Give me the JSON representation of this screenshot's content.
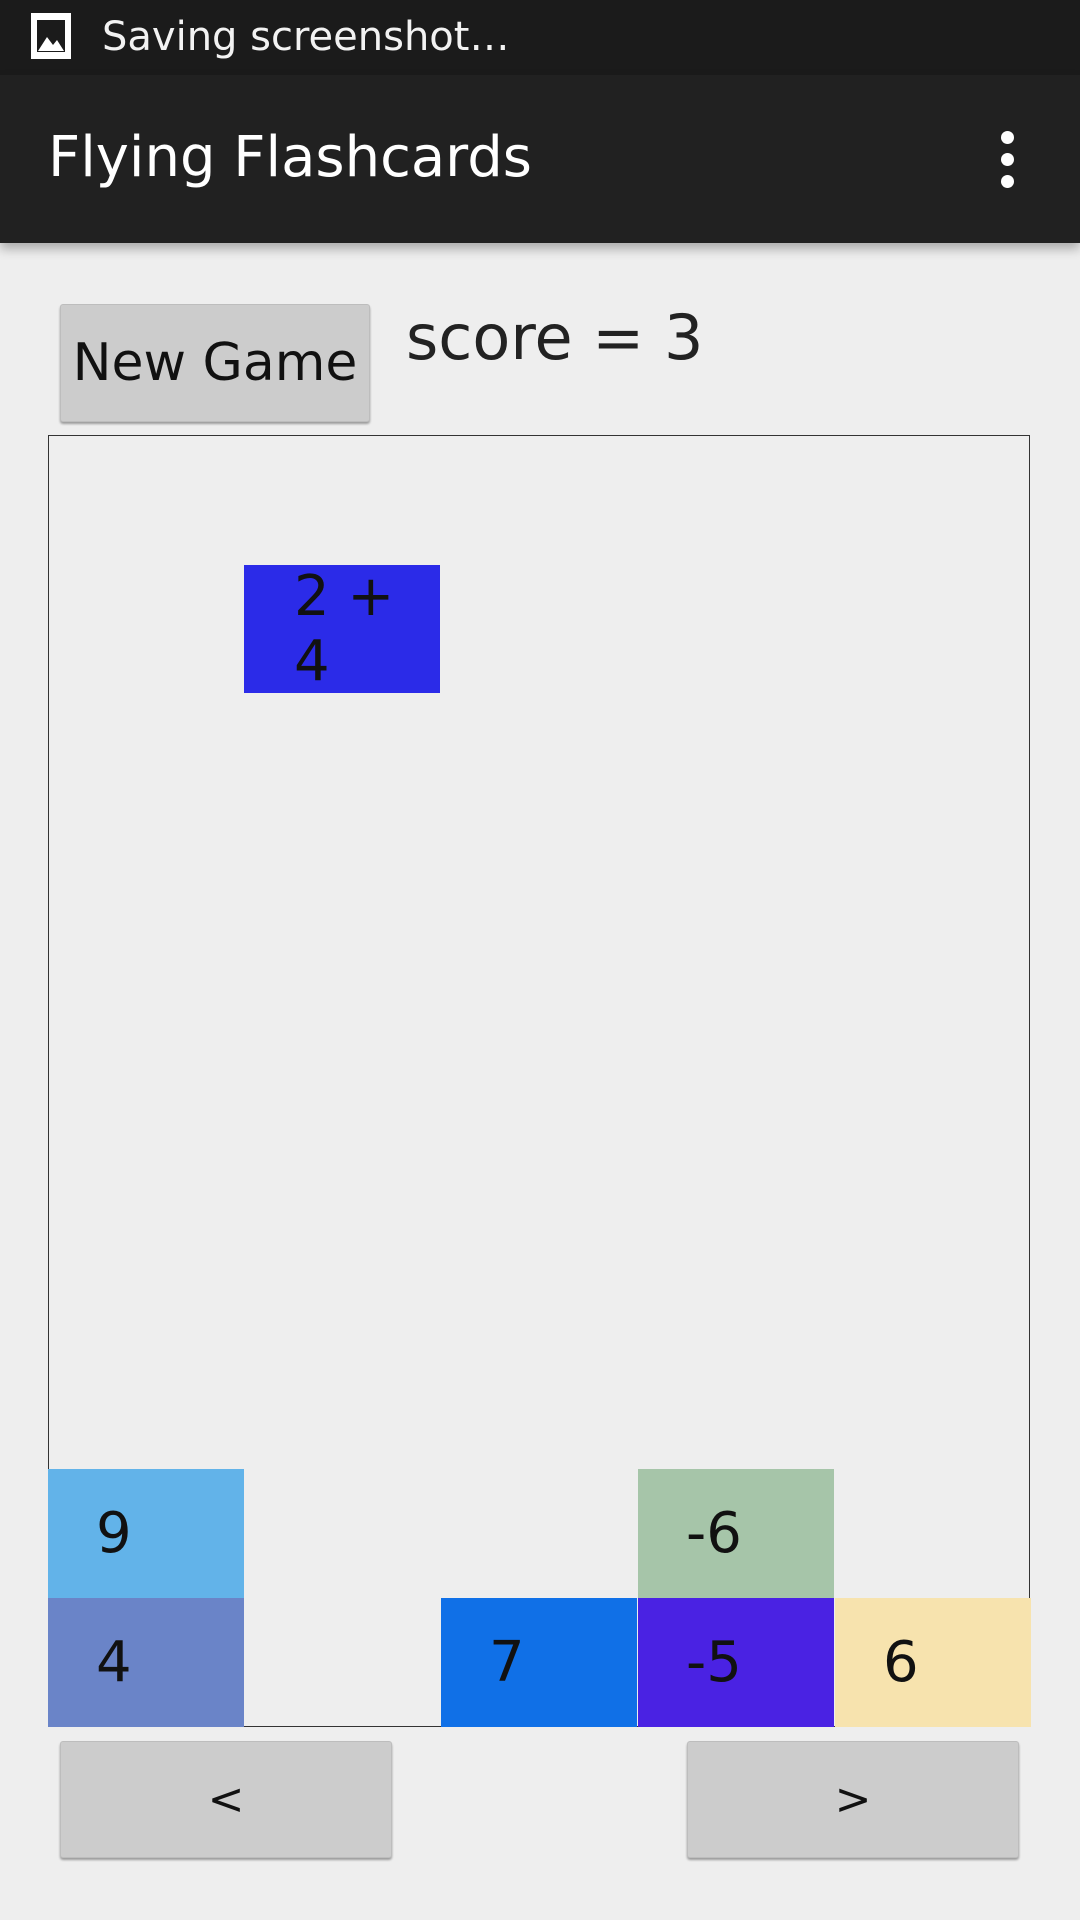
{
  "status_bar": {
    "notification_icon": "image-icon",
    "text": "Saving screenshot…"
  },
  "app_bar": {
    "title": "Flying Flashcards",
    "menu_icon": "overflow-menu-icon"
  },
  "controls": {
    "new_game_label": "New Game",
    "score_text": "score = 3"
  },
  "game_board": {
    "falling_card": {
      "text": "2 + 4",
      "color": "#2b2be8"
    },
    "stacked_cards": [
      {
        "text": "9",
        "color": "#62b3e9"
      },
      {
        "text": "4",
        "color": "#6a84c8"
      },
      {
        "text": "7",
        "color": "#1070e7"
      },
      {
        "text": "-6",
        "color": "#a6c5a9"
      },
      {
        "text": "-5",
        "color": "#4a22e3"
      },
      {
        "text": "6",
        "color": "#f7e3ae"
      }
    ]
  },
  "navigation": {
    "left_label": "<",
    "right_label": ">"
  }
}
